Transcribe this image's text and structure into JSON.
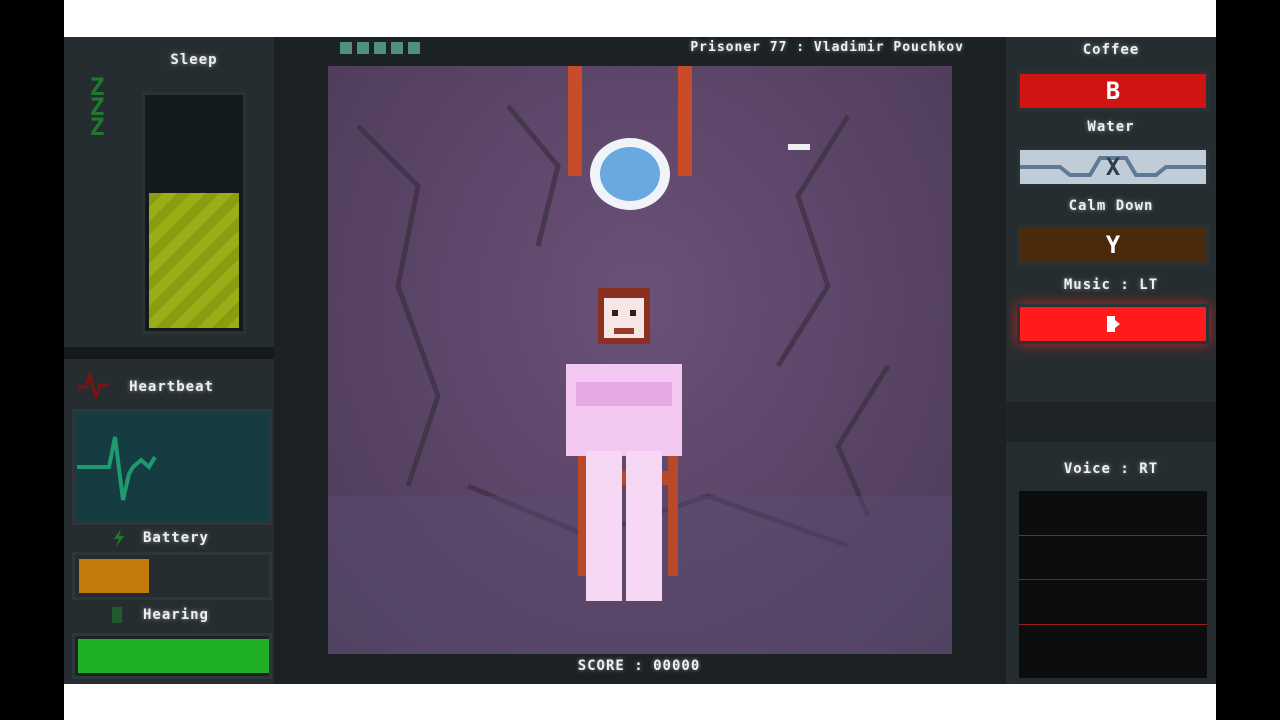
{
  "header": {
    "prisoner_label": "Prisoner 77 : Vladimir Pouchkov",
    "score_label": "SCORE : 00000"
  },
  "left": {
    "sleep_label": "Sleep",
    "sleep_level": 0.57,
    "heartbeat_label": "Heartbeat",
    "battery_label": "Battery",
    "battery_level": 0.36,
    "hearing_label": "Hearing",
    "hearing_level": 1.0
  },
  "right": {
    "coffee_label": "Coffee",
    "coffee_key": "B",
    "water_label": "Water",
    "water_key": "X",
    "calm_label": "Calm Down",
    "calm_key": "Y",
    "music_label": "Music : LT",
    "voice_label": "Voice : RT"
  },
  "colors": {
    "coffee": "#d01313",
    "water": "#c0ccd8",
    "calm": "#4a2a0a",
    "music": "#ff1b1b",
    "sleep_fill": "#8a9d10",
    "battery_fill": "#c27a0b",
    "hearing_fill": "#1fb028",
    "heartbeat_line": "#1f9a70"
  }
}
